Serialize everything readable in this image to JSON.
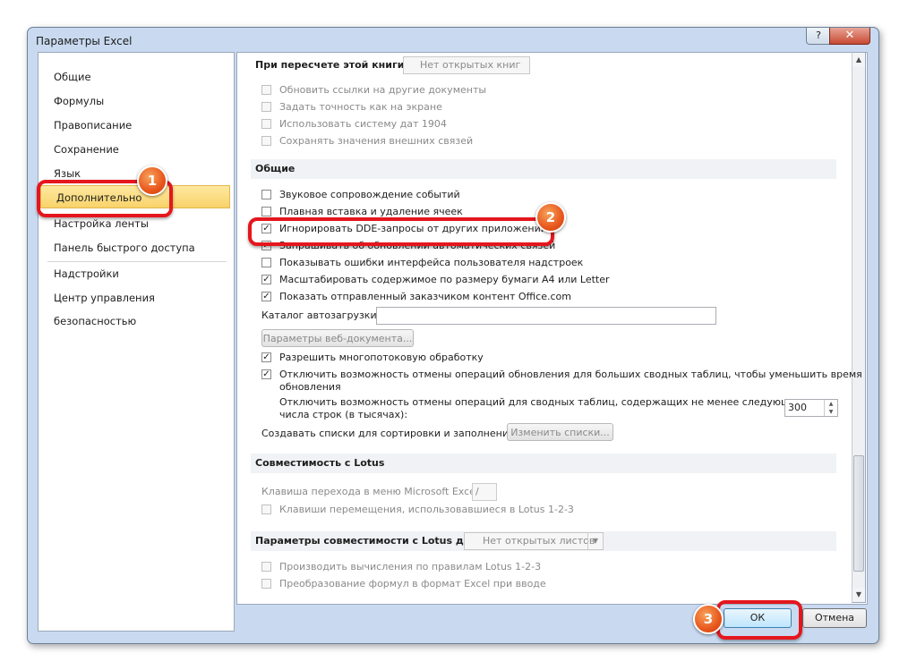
{
  "window": {
    "title": "Параметры Excel",
    "help": "?",
    "close": "✕"
  },
  "sidebar": {
    "items": [
      {
        "label": "Общие"
      },
      {
        "label": "Формулы"
      },
      {
        "label": "Правописание"
      },
      {
        "label": "Сохранение"
      },
      {
        "label": "Язык"
      },
      {
        "label": "Дополнительно"
      },
      {
        "label": "Настройка ленты"
      },
      {
        "label": "Панель быстрого доступа"
      },
      {
        "label": "Надстройки"
      },
      {
        "label": "Центр управления безопасностью"
      }
    ],
    "selected": "Дополнительно"
  },
  "content": {
    "top_partial": {
      "label": "При пересчете этой книги:",
      "dropdown_value": "Нет открытых книг"
    },
    "book_options": [
      {
        "label": "Обновить ссылки на другие документы",
        "checked": false
      },
      {
        "label": "Задать точность как на экране",
        "checked": false
      },
      {
        "label": "Использовать систему дат 1904",
        "checked": false
      },
      {
        "label": "Сохранять значения внешних связей",
        "checked": false
      }
    ],
    "general": {
      "header": "Общие",
      "options": [
        {
          "label": "Звуковое сопровождение событий",
          "checked": false
        },
        {
          "label": "Плавная вставка и удаление ячеек",
          "checked": false
        },
        {
          "label": "Игнорировать DDE-запросы от других приложений",
          "checked": true
        },
        {
          "label": "Запрашивать об обновлении автоматических связей",
          "checked": true
        },
        {
          "label": "Показывать ошибки интерфейса пользователя надстроек",
          "checked": false
        },
        {
          "label": "Масштабировать содержимое по размеру бумаги A4 или Letter",
          "checked": true
        },
        {
          "label": "Показать отправленный заказчиком контент Office.com",
          "checked": true
        }
      ],
      "autoload_label": "Каталог автозагрузки:",
      "autoload_value": "",
      "web_options_button": "Параметры веб-документа...",
      "multithread": {
        "label": "Разрешить многопотоковую обработку",
        "checked": true
      },
      "disable_undo_large": {
        "label_line1": "Отключить возможность отмены операций обновления для больших сводных таблиц, чтобы уменьшить время",
        "label_line2": "обновления",
        "checked": true
      },
      "undo_rows_line1": "Отключить возможность отмены операций для сводных таблиц, содержащих не менее следующего",
      "undo_rows_line2": "числа строк (в тысячах):",
      "undo_rows_value": "300",
      "sort_lists_label": "Создавать списки для сортировки и заполнения:",
      "edit_lists_button": "Изменить списки..."
    },
    "lotus": {
      "header": "Совместимость с Lotus",
      "menu_key_label": "Клавиша перехода в меню Microsoft Excel:",
      "menu_key_value": "/",
      "nav_keys": {
        "label": "Клавиши перемещения, использовавшиеся в Lotus 1-2-3",
        "checked": false
      }
    },
    "lotus_settings": {
      "header": "Параметры совместимости с Lotus для:",
      "dropdown_value": "Нет открытых листов",
      "options": [
        {
          "label": "Производить вычисления по правилам Lotus 1-2-3",
          "checked": false
        },
        {
          "label": "Преобразование формул в формат Excel при вводе",
          "checked": false
        }
      ]
    }
  },
  "footer": {
    "ok": "ОК",
    "cancel": "Отмена"
  },
  "callouts": [
    "1",
    "2",
    "3"
  ]
}
